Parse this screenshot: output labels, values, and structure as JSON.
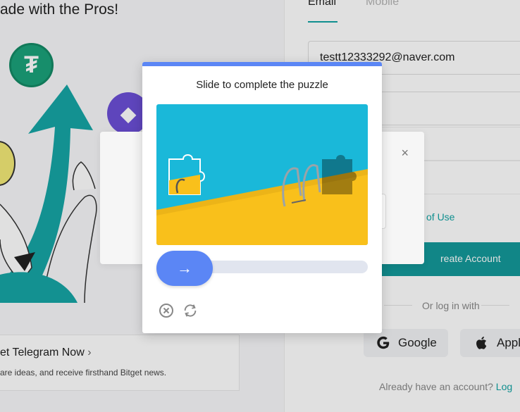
{
  "hero": {
    "title": "ade with the Pros!"
  },
  "coins": {
    "tether_symbol": "₮",
    "eth_symbol": "◆"
  },
  "telegram": {
    "title": "et Telegram Now",
    "chevron": "›",
    "subtitle": "are ideas, and receive firsthand Bitget news."
  },
  "form": {
    "tabs": [
      "Email",
      "Mobile"
    ],
    "email_value": "testt12333292@naver.com",
    "password_mask": "•••••••••",
    "terms_link": "of Use",
    "create_button": "reate Account",
    "or_divider": "Or log in with",
    "google_label": "Google",
    "apple_label": "Appl",
    "already_text": "Already have an account?",
    "login_link": "Log"
  },
  "under_modal": {
    "close_glyph": "×"
  },
  "captcha": {
    "title": "Slide to complete the puzzle",
    "slider_arrow": "→",
    "progress": 0,
    "accent_color": "#5b86f5"
  },
  "colors": {
    "brand": "#14999a",
    "captcha_accent": "#5b86f5",
    "pool_blue": "#1ab8d9",
    "pool_yellow": "#f9c01b"
  }
}
